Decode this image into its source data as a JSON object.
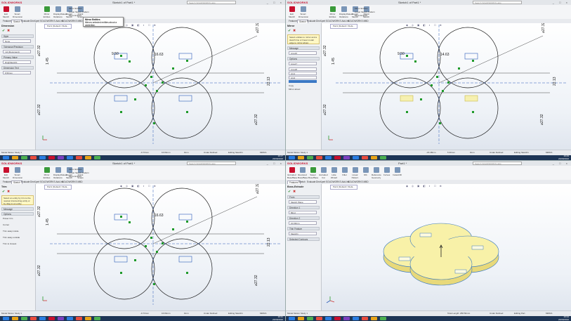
{
  "colors": {
    "brand": "#c8102e",
    "sketch_line": "#1a1a1a",
    "construction": "#2a5ab8",
    "relation": "#1f9a2a",
    "extrude_fill": "#f8f1a8",
    "extrude_edge": "#3b7ac0"
  },
  "app": {
    "logo": "SOLIDWORKS",
    "search_placeholder": "Search SOLIDWORKS Help",
    "window_controls": "_ □ ×"
  },
  "quadrants": [
    {
      "id": "q1",
      "doc_title": "Sketch1 of Part1 *",
      "ribbon_buttons": [
        "Exit Sketch",
        "Smart Dimension",
        "Mirror Entities",
        "Display/Delete Relations",
        "Repair Sketch",
        "Quick Snaps"
      ],
      "ribbon_list": [
        "Mirror Entities",
        "Linear Sketch Pattern",
        "Move Entities"
      ],
      "tabs": [
        "Features",
        "Sketch",
        "Evaluate",
        "DimXpert",
        "SOLIDWORKS Add-Ins",
        "SOLIDWORKS MBD"
      ],
      "active_tab": "Sketch",
      "breadcrumb": "Part1 (Default<<Defa...",
      "panel": {
        "title": "Dimension",
        "groups": [
          "Style",
          "Tolerance/Precision",
          "Primary Value",
          "Dimension Text"
        ],
        "fields": [
          "None",
          ".12 (Document)",
          "D1@Sketch1",
          "9.50mm"
        ],
        "tip": ""
      },
      "tooltip": {
        "title": "Mirror Entities",
        "body": "Mirrors selected entities about a centerline."
      },
      "dims": {
        "top": "16.63",
        "left_small": "9.50",
        "vert_left": "1.45",
        "dia_tl": "⌀27.32",
        "dia_lt": "⌀27.32",
        "dia_lb": "⌀27.32",
        "dia_rb": "⌀27.32",
        "right": "22.13"
      },
      "status": [
        "-9.73mm",
        "16.84mm",
        "0mm",
        "Under Defined",
        "Editing Sketch1",
        "MMGS"
      ],
      "status_bottom": "Model   Motion Study 1",
      "clock": {
        "time": "19:27",
        "date": "23/09/2016"
      }
    },
    {
      "id": "q2",
      "doc_title": "Sketch1 of Part1 *",
      "ribbon_buttons": [
        "Exit Sketch",
        "Smart Dimension",
        "Mirror Entities",
        "Display/Delete Relations",
        "Repair Sketch",
        "Rapid Sketch"
      ],
      "ribbon_list": [
        "Mirror Entities",
        "Linear Sketch Pattern",
        "Move Entities"
      ],
      "tabs": [
        "Features",
        "Sketch",
        "Evaluate",
        "DimXpert",
        "SOLIDWORKS Add-Ins",
        "SOLIDWORKS MBD"
      ],
      "active_tab": "Sketch",
      "breadcrumb": "Part1 (Default<<Defa...",
      "panel": {
        "title": "Mirror",
        "groups": [
          "Message",
          "Options"
        ],
        "fields": [
          "Line16",
          "Line17",
          "Line18",
          "Arc1",
          "Arc2"
        ],
        "tip": "Select entities to mirror and a sketch line or linear model edge to mirror about.",
        "checks": [
          "Copy",
          "Mirror about:"
        ]
      },
      "dims": {
        "top": "14.63",
        "left_small": "9.50",
        "vert_left": "1.45",
        "dia_tl": "⌀27.32",
        "dia_lt": "⌀27.32",
        "dia_lb": "⌀27.32",
        "dia_rb": "⌀27.32",
        "right": "22.13"
      },
      "status": [
        "-15.48mm",
        "5.30mm",
        "0mm",
        "Under Defined",
        "Editing Sketch1",
        "MMGS"
      ],
      "status_bottom": "Model   Motion Study 1",
      "clock": {
        "time": "19:29",
        "date": "23/09/2016"
      }
    },
    {
      "id": "q3",
      "doc_title": "Sketch1 of Part1 *",
      "ribbon_buttons": [
        "Exit Sketch",
        "Smart Dimension",
        "Mirror Entities",
        "Display/Delete Relations",
        "Repair Sketch",
        "Quick Snaps"
      ],
      "ribbon_list": [
        "Mirror Entities",
        "Linear Sketch Pattern",
        "Move Entities"
      ],
      "tabs": [
        "Features",
        "Sketch",
        "Evaluate",
        "DimXpert",
        "SOLIDWORKS Add-Ins",
        "SOLIDWORKS MBD"
      ],
      "active_tab": "Sketch",
      "breadcrumb": "Part1 (Default<<Defa...",
      "panel": {
        "title": "Trim",
        "groups": [
          "Message",
          "Options"
        ],
        "fields": [],
        "tip": "Select an entity by trim to the nearest intersecting entity or by drag to an entity.",
        "options": [
          "Power trim",
          "Corner",
          "Trim away inside",
          "Trim away outside",
          "Trim to closest"
        ]
      },
      "dims": {
        "top": "16.63",
        "left_small": "",
        "vert_left": "1.45",
        "dia_tl": "⌀27.32",
        "dia_lt": "⌀27.32",
        "dia_lb": "⌀27.32",
        "dia_rb": "⌀27.32",
        "right": "22.13"
      },
      "status": [
        "-9.73mm",
        "16.84mm",
        "0mm",
        "Under Defined",
        "Editing Sketch1",
        "MMGS"
      ],
      "status_bottom": "Model   Motion Study 1",
      "clock": {
        "time": "19:31",
        "date": "23/09/2016"
      }
    },
    {
      "id": "q4",
      "doc_title": "Part1 *",
      "ribbon_buttons": [
        "Extruded Boss/Base",
        "Revolved Boss/Base",
        "Swept Boss/Base",
        "Extruded Cut",
        "Hole Wizard",
        "Fillet",
        "Linear Pattern",
        "Rib",
        "Reference Geometry",
        "Curves",
        "Instant3D"
      ],
      "ribbon_list": [],
      "tabs": [
        "Features",
        "Sketch",
        "Evaluate",
        "DimXpert",
        "SOLIDWORKS Add-Ins",
        "SOLIDWORKS MBD"
      ],
      "active_tab": "Features",
      "breadcrumb": "Part1 (Default<<Defa...",
      "panel": {
        "title": "Boss-Extrude",
        "groups": [
          "From",
          "Direction 1",
          "Direction 2",
          "Thin Feature",
          "Selected Contours"
        ],
        "fields": [
          "Sketch Plane",
          "Blind",
          "10.00mm",
          "Sketch1"
        ],
        "tip": ""
      },
      "dims": {},
      "status": [
        "Total Length: 258.50mm",
        "Under Defined",
        "Editing Part",
        "MMGS"
      ],
      "status_bottom": "Model   Motion Study 1",
      "clock": {
        "time": "19:34",
        "date": "23/09/2016"
      }
    }
  ]
}
